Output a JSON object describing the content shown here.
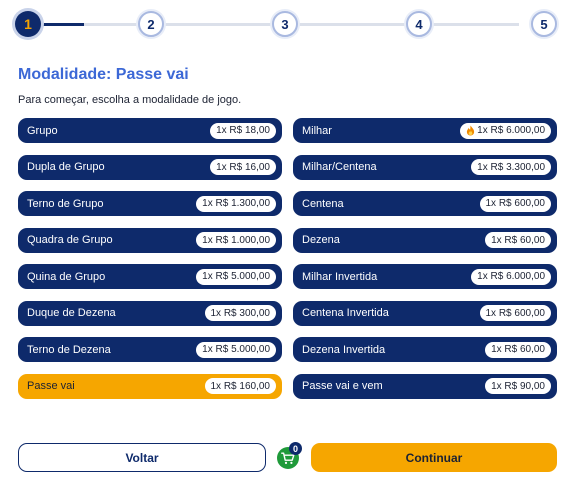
{
  "stepper": {
    "steps": [
      "1",
      "2",
      "3",
      "4",
      "5"
    ],
    "current": 1
  },
  "header": {
    "title": "Modalidade: Passe vai",
    "subtitle": "Para começar, escolha a modalidade de jogo."
  },
  "options_left": [
    {
      "label": "Grupo",
      "price": "1x R$ 18,00"
    },
    {
      "label": "Dupla de Grupo",
      "price": "1x R$ 16,00"
    },
    {
      "label": "Terno de Grupo",
      "price": "1x R$ 1.300,00"
    },
    {
      "label": "Quadra de Grupo",
      "price": "1x R$ 1.000,00"
    },
    {
      "label": "Quina de Grupo",
      "price": "1x R$ 5.000,00"
    },
    {
      "label": "Duque de Dezena",
      "price": "1x R$ 300,00"
    },
    {
      "label": "Terno de Dezena",
      "price": "1x R$ 5.000,00"
    },
    {
      "label": "Passe vai",
      "price": "1x R$ 160,00",
      "selected": true
    }
  ],
  "options_right": [
    {
      "label": "Milhar",
      "price": "1x R$ 6.000,00",
      "icon": "fire-icon"
    },
    {
      "label": "Milhar/Centena",
      "price": "1x R$ 3.300,00"
    },
    {
      "label": "Centena",
      "price": "1x R$ 600,00"
    },
    {
      "label": "Dezena",
      "price": "1x R$ 60,00"
    },
    {
      "label": "Milhar Invertida",
      "price": "1x R$ 6.000,00"
    },
    {
      "label": "Centena Invertida",
      "price": "1x R$ 600,00"
    },
    {
      "label": "Dezena Invertida",
      "price": "1x R$ 60,00"
    },
    {
      "label": "Passe vai e vem",
      "price": "1x R$ 90,00"
    }
  ],
  "footer": {
    "back_label": "Voltar",
    "continue_label": "Continuar",
    "cart_count": "0",
    "cart_icon": "cart-icon"
  },
  "colors": {
    "navy": "#0e2a6b",
    "accent": "#f6a600",
    "title_blue": "#3c68d6",
    "cart_green": "#1f9a3a"
  }
}
